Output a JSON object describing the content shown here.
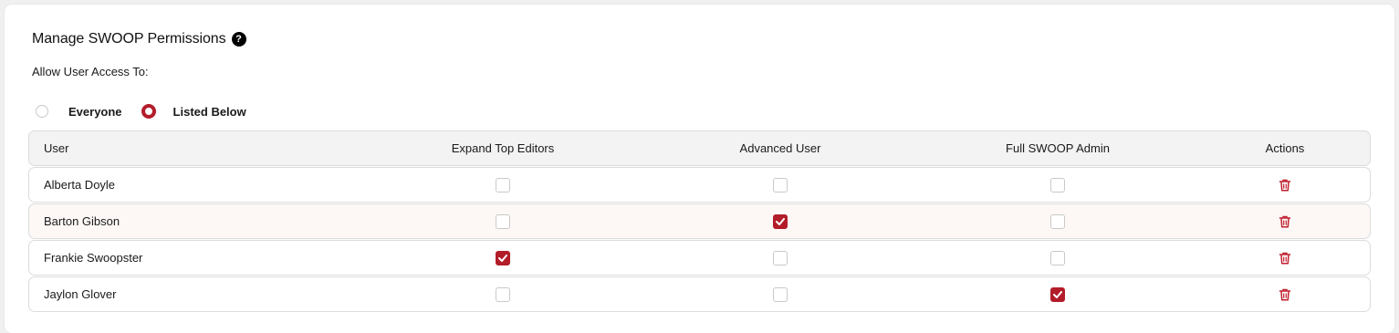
{
  "section": {
    "title": "Manage SWOOP Permissions",
    "help_icon": "question-circle-icon",
    "subtitle": "Allow User Access To:"
  },
  "access": {
    "options": [
      {
        "label": "Everyone",
        "selected": false
      },
      {
        "label": "Listed Below",
        "selected": true
      }
    ]
  },
  "table": {
    "columns": [
      "User",
      "Expand Top Editors",
      "Advanced User",
      "Full SWOOP Admin",
      "Actions"
    ],
    "rows": [
      {
        "user": "Alberta Doyle",
        "expand_top_editors": false,
        "advanced_user": false,
        "full_swoop_admin": false,
        "action_icon": "trash-icon"
      },
      {
        "user": "Barton Gibson",
        "expand_top_editors": false,
        "advanced_user": true,
        "full_swoop_admin": false,
        "action_icon": "trash-icon"
      },
      {
        "user": "Frankie Swoopster",
        "expand_top_editors": true,
        "advanced_user": false,
        "full_swoop_admin": false,
        "action_icon": "trash-icon"
      },
      {
        "user": "Jaylon Glover",
        "expand_top_editors": false,
        "advanced_user": false,
        "full_swoop_admin": true,
        "action_icon": "trash-icon"
      }
    ]
  },
  "colors": {
    "accent": "#b31d2a",
    "header_bg": "#f3f3f3",
    "row_border": "#dcdcdc",
    "hover_row_bg": "#fdf8f6"
  }
}
